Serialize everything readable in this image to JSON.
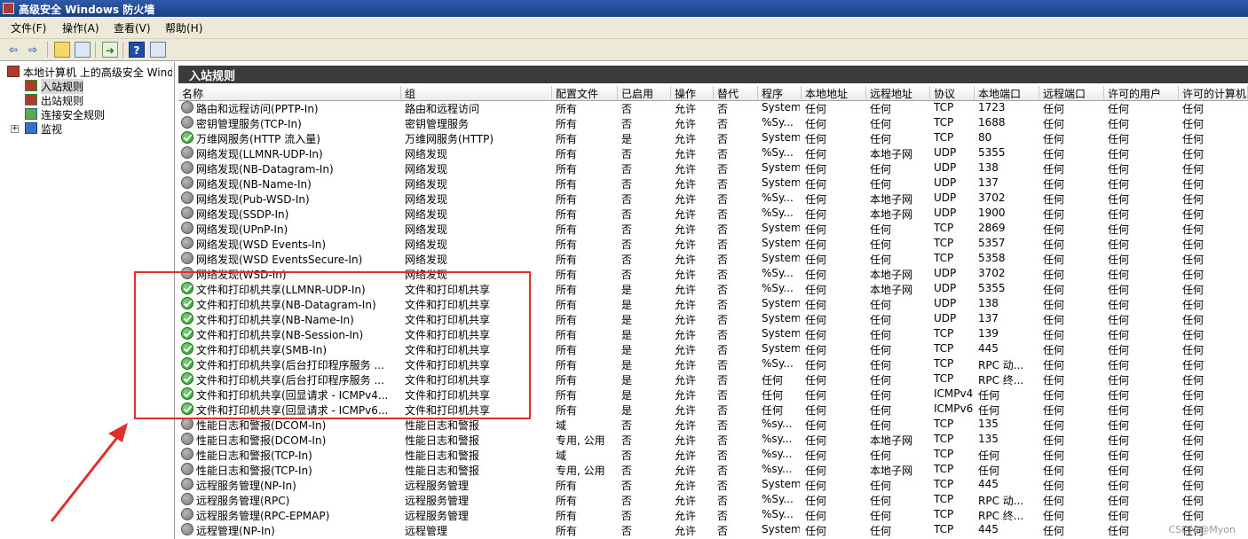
{
  "window": {
    "title": "高级安全 Windows 防火墙"
  },
  "menu": [
    {
      "label": "文件(F)"
    },
    {
      "label": "操作(A)"
    },
    {
      "label": "查看(V)"
    },
    {
      "label": "帮助(H)"
    }
  ],
  "tree": {
    "root": "本地计算机 上的高级安全 Windows 防火墙",
    "items": [
      {
        "label": "入站规则",
        "selected": true
      },
      {
        "label": "出站规则"
      },
      {
        "label": "连接安全规则"
      },
      {
        "label": "监视"
      }
    ]
  },
  "content": {
    "header": "入站规则",
    "columns": [
      "名称",
      "组",
      "配置文件",
      "已启用",
      "操作",
      "替代",
      "程序",
      "本地地址",
      "远程地址",
      "协议",
      "本地端口",
      "远程端口",
      "许可的用户",
      "许可的计算机"
    ],
    "rows": [
      {
        "enabled": false,
        "cells": [
          "路由和远程访问(PPTP-In)",
          "路由和远程访问",
          "所有",
          "否",
          "允许",
          "否",
          "System",
          "任何",
          "任何",
          "TCP",
          "1723",
          "任何",
          "任何",
          "任何"
        ]
      },
      {
        "enabled": false,
        "cells": [
          "密钥管理服务(TCP-In)",
          "密钥管理服务",
          "所有",
          "否",
          "允许",
          "否",
          "%Sy...",
          "任何",
          "任何",
          "TCP",
          "1688",
          "任何",
          "任何",
          "任何"
        ]
      },
      {
        "enabled": true,
        "cells": [
          "万维网服务(HTTP 流入量)",
          "万维网服务(HTTP)",
          "所有",
          "是",
          "允许",
          "否",
          "System",
          "任何",
          "任何",
          "TCP",
          "80",
          "任何",
          "任何",
          "任何"
        ]
      },
      {
        "enabled": false,
        "cells": [
          "网络发现(LLMNR-UDP-In)",
          "网络发现",
          "所有",
          "否",
          "允许",
          "否",
          "%Sy...",
          "任何",
          "本地子网",
          "UDP",
          "5355",
          "任何",
          "任何",
          "任何"
        ]
      },
      {
        "enabled": false,
        "cells": [
          "网络发现(NB-Datagram-In)",
          "网络发现",
          "所有",
          "否",
          "允许",
          "否",
          "System",
          "任何",
          "任何",
          "UDP",
          "138",
          "任何",
          "任何",
          "任何"
        ]
      },
      {
        "enabled": false,
        "cells": [
          "网络发现(NB-Name-In)",
          "网络发现",
          "所有",
          "否",
          "允许",
          "否",
          "System",
          "任何",
          "任何",
          "UDP",
          "137",
          "任何",
          "任何",
          "任何"
        ]
      },
      {
        "enabled": false,
        "cells": [
          "网络发现(Pub-WSD-In)",
          "网络发现",
          "所有",
          "否",
          "允许",
          "否",
          "%Sy...",
          "任何",
          "本地子网",
          "UDP",
          "3702",
          "任何",
          "任何",
          "任何"
        ]
      },
      {
        "enabled": false,
        "cells": [
          "网络发现(SSDP-In)",
          "网络发现",
          "所有",
          "否",
          "允许",
          "否",
          "%Sy...",
          "任何",
          "本地子网",
          "UDP",
          "1900",
          "任何",
          "任何",
          "任何"
        ]
      },
      {
        "enabled": false,
        "cells": [
          "网络发现(UPnP-In)",
          "网络发现",
          "所有",
          "否",
          "允许",
          "否",
          "System",
          "任何",
          "任何",
          "TCP",
          "2869",
          "任何",
          "任何",
          "任何"
        ]
      },
      {
        "enabled": false,
        "cells": [
          "网络发现(WSD Events-In)",
          "网络发现",
          "所有",
          "否",
          "允许",
          "否",
          "System",
          "任何",
          "任何",
          "TCP",
          "5357",
          "任何",
          "任何",
          "任何"
        ]
      },
      {
        "enabled": false,
        "cells": [
          "网络发现(WSD EventsSecure-In)",
          "网络发现",
          "所有",
          "否",
          "允许",
          "否",
          "System",
          "任何",
          "任何",
          "TCP",
          "5358",
          "任何",
          "任何",
          "任何"
        ]
      },
      {
        "enabled": false,
        "cells": [
          "网络发现(WSD-In)",
          "网络发现",
          "所有",
          "否",
          "允许",
          "否",
          "%Sy...",
          "任何",
          "本地子网",
          "UDP",
          "3702",
          "任何",
          "任何",
          "任何"
        ]
      },
      {
        "enabled": true,
        "cells": [
          "文件和打印机共享(LLMNR-UDP-In)",
          "文件和打印机共享",
          "所有",
          "是",
          "允许",
          "否",
          "%Sy...",
          "任何",
          "本地子网",
          "UDP",
          "5355",
          "任何",
          "任何",
          "任何"
        ]
      },
      {
        "enabled": true,
        "cells": [
          "文件和打印机共享(NB-Datagram-In)",
          "文件和打印机共享",
          "所有",
          "是",
          "允许",
          "否",
          "System",
          "任何",
          "任何",
          "UDP",
          "138",
          "任何",
          "任何",
          "任何"
        ]
      },
      {
        "enabled": true,
        "cells": [
          "文件和打印机共享(NB-Name-In)",
          "文件和打印机共享",
          "所有",
          "是",
          "允许",
          "否",
          "System",
          "任何",
          "任何",
          "UDP",
          "137",
          "任何",
          "任何",
          "任何"
        ]
      },
      {
        "enabled": true,
        "cells": [
          "文件和打印机共享(NB-Session-In)",
          "文件和打印机共享",
          "所有",
          "是",
          "允许",
          "否",
          "System",
          "任何",
          "任何",
          "TCP",
          "139",
          "任何",
          "任何",
          "任何"
        ]
      },
      {
        "enabled": true,
        "cells": [
          "文件和打印机共享(SMB-In)",
          "文件和打印机共享",
          "所有",
          "是",
          "允许",
          "否",
          "System",
          "任何",
          "任何",
          "TCP",
          "445",
          "任何",
          "任何",
          "任何"
        ]
      },
      {
        "enabled": true,
        "cells": [
          "文件和打印机共享(后台打印程序服务 ...",
          "文件和打印机共享",
          "所有",
          "是",
          "允许",
          "否",
          "%Sy...",
          "任何",
          "任何",
          "TCP",
          "RPC 动...",
          "任何",
          "任何",
          "任何"
        ]
      },
      {
        "enabled": true,
        "cells": [
          "文件和打印机共享(后台打印程序服务 ...",
          "文件和打印机共享",
          "所有",
          "是",
          "允许",
          "否",
          "任何",
          "任何",
          "任何",
          "TCP",
          "RPC 终...",
          "任何",
          "任何",
          "任何"
        ]
      },
      {
        "enabled": true,
        "cells": [
          "文件和打印机共享(回显请求 - ICMPv4...",
          "文件和打印机共享",
          "所有",
          "是",
          "允许",
          "否",
          "任何",
          "任何",
          "任何",
          "ICMPv4",
          "任何",
          "任何",
          "任何",
          "任何"
        ]
      },
      {
        "enabled": true,
        "cells": [
          "文件和打印机共享(回显请求 - ICMPv6...",
          "文件和打印机共享",
          "所有",
          "是",
          "允许",
          "否",
          "任何",
          "任何",
          "任何",
          "ICMPv6",
          "任何",
          "任何",
          "任何",
          "任何"
        ]
      },
      {
        "enabled": false,
        "cells": [
          "性能日志和警报(DCOM-In)",
          "性能日志和警报",
          "域",
          "否",
          "允许",
          "否",
          "%sy...",
          "任何",
          "任何",
          "TCP",
          "135",
          "任何",
          "任何",
          "任何"
        ]
      },
      {
        "enabled": false,
        "cells": [
          "性能日志和警报(DCOM-In)",
          "性能日志和警报",
          "专用, 公用",
          "否",
          "允许",
          "否",
          "%sy...",
          "任何",
          "本地子网",
          "TCP",
          "135",
          "任何",
          "任何",
          "任何"
        ]
      },
      {
        "enabled": false,
        "cells": [
          "性能日志和警报(TCP-In)",
          "性能日志和警报",
          "域",
          "否",
          "允许",
          "否",
          "%sy...",
          "任何",
          "任何",
          "TCP",
          "任何",
          "任何",
          "任何",
          "任何"
        ]
      },
      {
        "enabled": false,
        "cells": [
          "性能日志和警报(TCP-In)",
          "性能日志和警报",
          "专用, 公用",
          "否",
          "允许",
          "否",
          "%sy...",
          "任何",
          "本地子网",
          "TCP",
          "任何",
          "任何",
          "任何",
          "任何"
        ]
      },
      {
        "enabled": false,
        "cells": [
          "远程服务管理(NP-In)",
          "远程服务管理",
          "所有",
          "否",
          "允许",
          "否",
          "System",
          "任何",
          "任何",
          "TCP",
          "445",
          "任何",
          "任何",
          "任何"
        ]
      },
      {
        "enabled": false,
        "cells": [
          "远程服务管理(RPC)",
          "远程服务管理",
          "所有",
          "否",
          "允许",
          "否",
          "%Sy...",
          "任何",
          "任何",
          "TCP",
          "RPC 动...",
          "任何",
          "任何",
          "任何"
        ]
      },
      {
        "enabled": false,
        "cells": [
          "远程服务管理(RPC-EPMAP)",
          "远程服务管理",
          "所有",
          "否",
          "允许",
          "否",
          "%Sy...",
          "任何",
          "任何",
          "TCP",
          "RPC 终...",
          "任何",
          "任何",
          "任何"
        ]
      },
      {
        "enabled": false,
        "cells": [
          "远程管理(NP-In)",
          "远程管理",
          "所有",
          "否",
          "允许",
          "否",
          "System",
          "任何",
          "任何",
          "TCP",
          "445",
          "任何",
          "任何",
          "任何"
        ]
      }
    ]
  },
  "watermark": "CSDN @Myon⁠",
  "colors": {
    "highlight": "#e0302c",
    "headerBar": "#3b3b3b",
    "titleBar": "#1c3f86"
  }
}
